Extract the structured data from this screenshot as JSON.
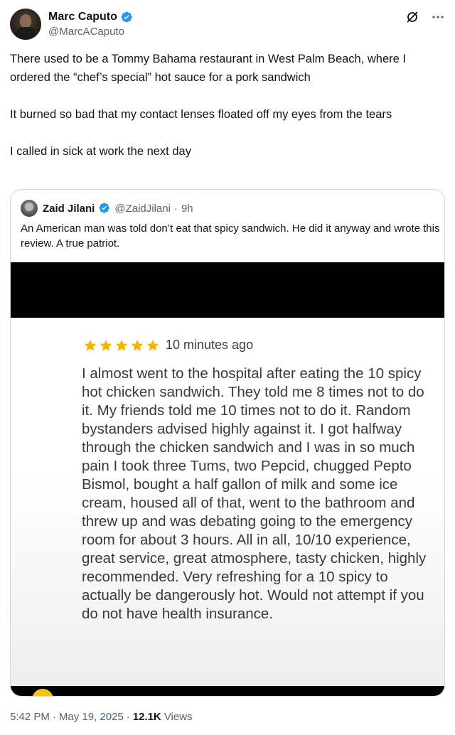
{
  "tweet": {
    "author": {
      "name": "Marc Caputo",
      "handle": "@MarcACaputo",
      "verified": true
    },
    "paragraphs": [
      "There used to be a Tommy Bahama restaurant in West Palm Beach, where I ordered the “chef’s special” hot sauce for a pork sandwich",
      "It burned so bad that my contact lenses floated off my eyes from the tears",
      "I called in sick at work the next day"
    ],
    "meta": {
      "time": "5:42 PM",
      "sep1": "·",
      "date": "May 19, 2025",
      "sep2": "·",
      "views_count": "12.1K",
      "views_label": "Views"
    }
  },
  "quote": {
    "author": {
      "name": "Zaid Jilani",
      "handle": "@ZaidJilani",
      "dot": "·",
      "time": "9h",
      "verified": true
    },
    "text": "An American man was told don’t eat that spicy sandwich. He did it anyway and wrote this review.  A true patriot.",
    "media": {
      "review": {
        "rating_stars": 5,
        "time": "10 minutes ago",
        "text": "I almost went to the hospital after eating the 10 spicy hot chicken sandwich. They told me 8 times not to do it. My friends told me 10 times not to do it. Random bystanders advised highly against it. I got halfway through the chicken sandwich and I was in so much pain I took three Tums, two Pepcid, chugged Pepto Bismol, bought a half gallon of milk and some ice cream, housed all of that, went to the bathroom and threw up and was debating going to the emergency room for about 3 hours. All in all, 10/10 experience, great service, great atmosphere, tasty chicken, highly recommended. Very refreshing for a 10 spicy to actually be dangerously hot. Would not attempt if you do not have health insurance."
      }
    }
  },
  "icons": {
    "verified": "verified-badge-icon",
    "grok": "grok-icon",
    "more": "more-icon",
    "star": "star-icon"
  },
  "colors": {
    "verified_blue": "#1d9bf0",
    "text_primary": "#0f1419",
    "text_secondary": "#536471",
    "star_gold": "#f4b400",
    "border": "#cfd9de"
  }
}
